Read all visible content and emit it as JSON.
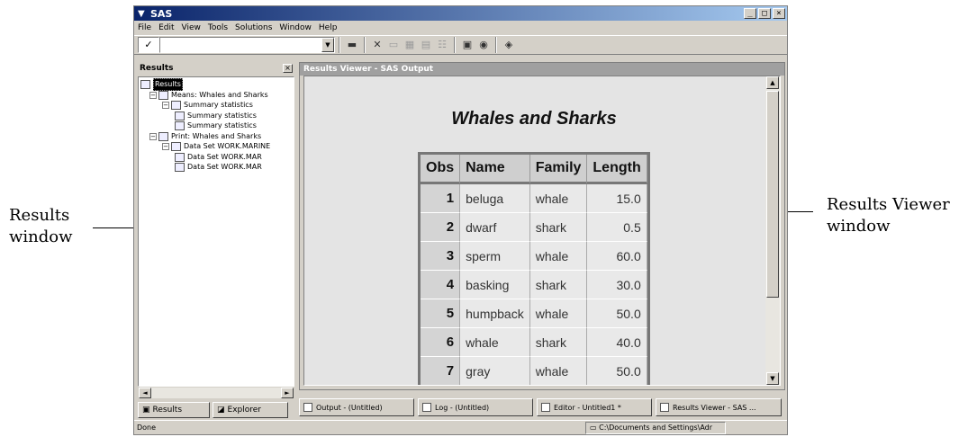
{
  "annotations": {
    "left_line1": "Results",
    "left_line2": "window",
    "right_line1": "Results Viewer",
    "right_line2": "window"
  },
  "window": {
    "title": "SAS",
    "minimize": "_",
    "maximize": "□",
    "close": "×"
  },
  "menu": [
    "File",
    "Edit",
    "View",
    "Tools",
    "Solutions",
    "Window",
    "Help"
  ],
  "toolbar": {
    "check_glyph": "✓",
    "command_value": "",
    "icons": [
      "folder-icon",
      "delete-icon",
      "properties-icon",
      "large-icons-icon",
      "tree-icon",
      "details-icon",
      "results-icon",
      "preview-icon",
      "help-icon"
    ]
  },
  "results_pane": {
    "header": "Results",
    "close": "×",
    "tree": [
      {
        "label": "Results",
        "level": 0,
        "selected": true
      },
      {
        "label": "Means:  Whales and Sharks",
        "level": 1
      },
      {
        "label": "Summary statistics",
        "level": 2
      },
      {
        "label": "Summary statistics",
        "level": 3
      },
      {
        "label": "Summary statistics",
        "level": 3
      },
      {
        "label": "Print:  Whales and Sharks",
        "level": 1
      },
      {
        "label": "Data Set WORK.MARINE",
        "level": 2
      },
      {
        "label": "Data Set WORK.MAR",
        "level": 3
      },
      {
        "label": "Data Set WORK.MAR",
        "level": 3
      }
    ],
    "tabs": [
      {
        "label": "Results"
      },
      {
        "label": "Explorer"
      }
    ]
  },
  "viewer": {
    "title": "Results Viewer - SAS Output",
    "report_title": "Whales and Sharks",
    "columns": [
      "Obs",
      "Name",
      "Family",
      "Length"
    ],
    "rows": [
      [
        "1",
        "beluga",
        "whale",
        "15.0"
      ],
      [
        "2",
        "dwarf",
        "shark",
        "0.5"
      ],
      [
        "3",
        "sperm",
        "whale",
        "60.0"
      ],
      [
        "4",
        "basking",
        "shark",
        "30.0"
      ],
      [
        "5",
        "humpback",
        "whale",
        "50.0"
      ],
      [
        "6",
        "whale",
        "shark",
        "40.0"
      ],
      [
        "7",
        "gray",
        "whale",
        "50.0"
      ]
    ]
  },
  "doc_tabs": [
    {
      "label": "Output - (Untitled)"
    },
    {
      "label": "Log - (Untitled)"
    },
    {
      "label": "Editor - Untitled1 *"
    },
    {
      "label": "Results Viewer - SAS ..."
    }
  ],
  "status": {
    "left": "Done",
    "path": "C:\\Documents and Settings\\Adr"
  }
}
